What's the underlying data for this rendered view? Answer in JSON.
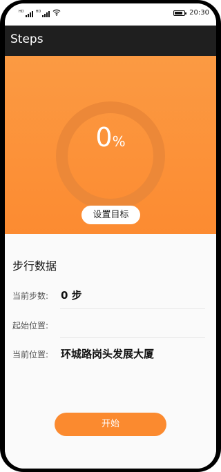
{
  "status_bar": {
    "signal_1_label": "HD",
    "signal_2_label": "HD",
    "time": "20:30",
    "battery_level": 0.85
  },
  "app_bar": {
    "title": "Steps"
  },
  "progress": {
    "value": "0",
    "unit": "%",
    "percent": 0,
    "set_goal_label": "设置目标"
  },
  "step_data": {
    "section_title": "步行数据",
    "current_steps_label": "当前步数:",
    "current_steps_value": "0 步",
    "start_location_label": "起始位置:",
    "start_location_value": "",
    "current_location_label": "当前位置:",
    "current_location_value": "环城路岗头发展大厦"
  },
  "actions": {
    "start_label": "开始"
  },
  "colors": {
    "accent": "#fb8a2f",
    "ring": "#ec8838",
    "app_bar": "#1f1f1f"
  }
}
